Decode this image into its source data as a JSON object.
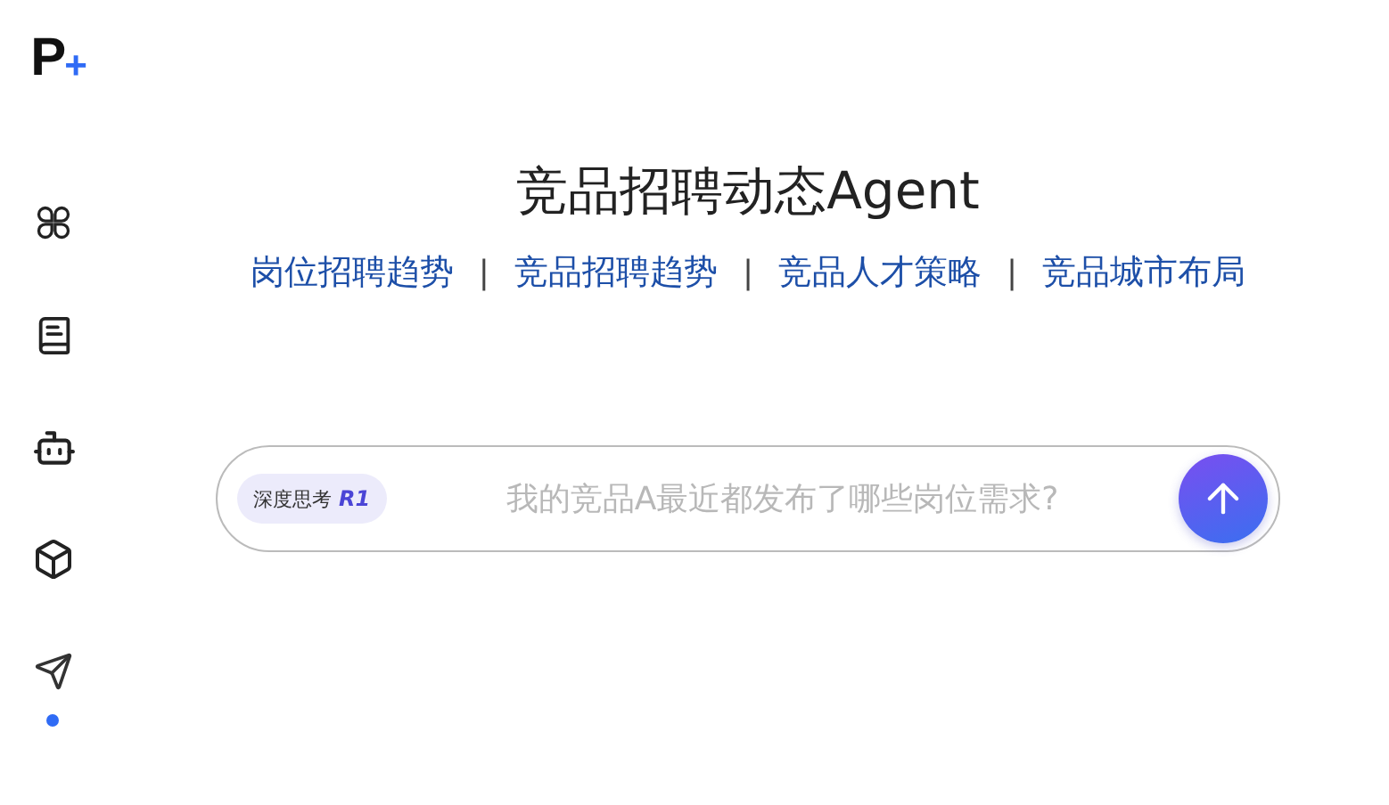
{
  "logo": {
    "letter": "P",
    "mark": "+"
  },
  "sidebar": {
    "items": [
      {
        "selected": false
      },
      {
        "selected": false
      },
      {
        "selected": false
      },
      {
        "selected": false
      },
      {
        "selected": true
      }
    ]
  },
  "title": "竞品招聘动态Agent",
  "suggestions": [
    {
      "kind": "link",
      "text": "岗位招聘趋势"
    },
    {
      "kind": "separator",
      "text": "|"
    },
    {
      "kind": "link",
      "text": "竞品招聘趋势"
    },
    {
      "kind": "separator",
      "text": "|"
    },
    {
      "kind": "link",
      "text": "竞品人才策略"
    },
    {
      "kind": "separator",
      "text": "|"
    },
    {
      "kind": "link",
      "text": "竞品城市布局"
    }
  ],
  "composer": {
    "mode_badge": {
      "label": "深度思考",
      "model": "R1",
      "selected": true
    },
    "placeholder": "我的竞品A最近都发布了哪些岗位需求?"
  }
}
